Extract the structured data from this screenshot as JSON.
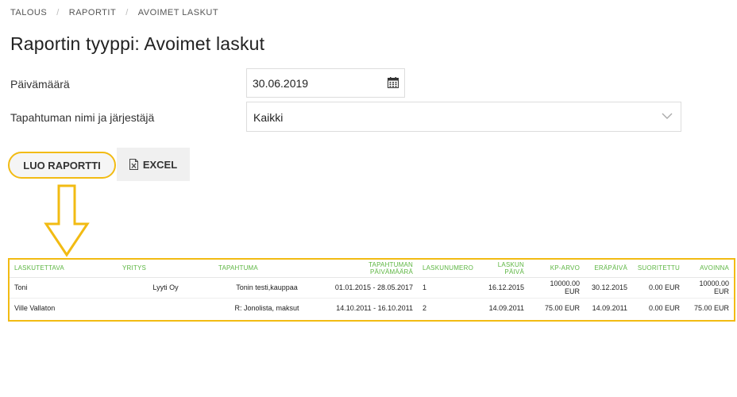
{
  "breadcrumb": [
    "TALOUS",
    "RAPORTIT",
    "AVOIMET LASKUT"
  ],
  "page_title": "Raportin tyyppi: Avoimet laskut",
  "form": {
    "date_label": "Päivämäärä",
    "date_value": "30.06.2019",
    "event_label": "Tapahtuman nimi ja järjestäjä",
    "event_value": "Kaikki"
  },
  "buttons": {
    "create_report": "LUO RAPORTTI",
    "excel": "EXCEL"
  },
  "accent_colors": {
    "highlight": "#f2bb13",
    "header_text": "#5db642"
  },
  "table": {
    "headers": [
      "LASKUTETTAVA",
      "YRITYS",
      "TAPAHTUMA",
      "TAPAHTUMAN PÄIVÄMÄÄRÄ",
      "LASKUNUMERO",
      "LASKUN PÄIVÄ",
      "KP-ARVO",
      "ERÄPÄIVÄ",
      "SUORITETTU",
      "AVOINNA"
    ],
    "rows": [
      [
        "Toni",
        "Lyyti Oy",
        "Tonin testi,kauppaa",
        "01.01.2015 - 28.05.2017",
        "1",
        "16.12.2015",
        "10000.00 EUR",
        "30.12.2015",
        "0.00 EUR",
        "10000.00 EUR"
      ],
      [
        "Ville Vallaton",
        "",
        "R: Jonolista, maksut",
        "14.10.2011 - 16.10.2011",
        "2",
        "14.09.2011",
        "75.00 EUR",
        "14.09.2011",
        "0.00 EUR",
        "75.00 EUR"
      ]
    ]
  }
}
